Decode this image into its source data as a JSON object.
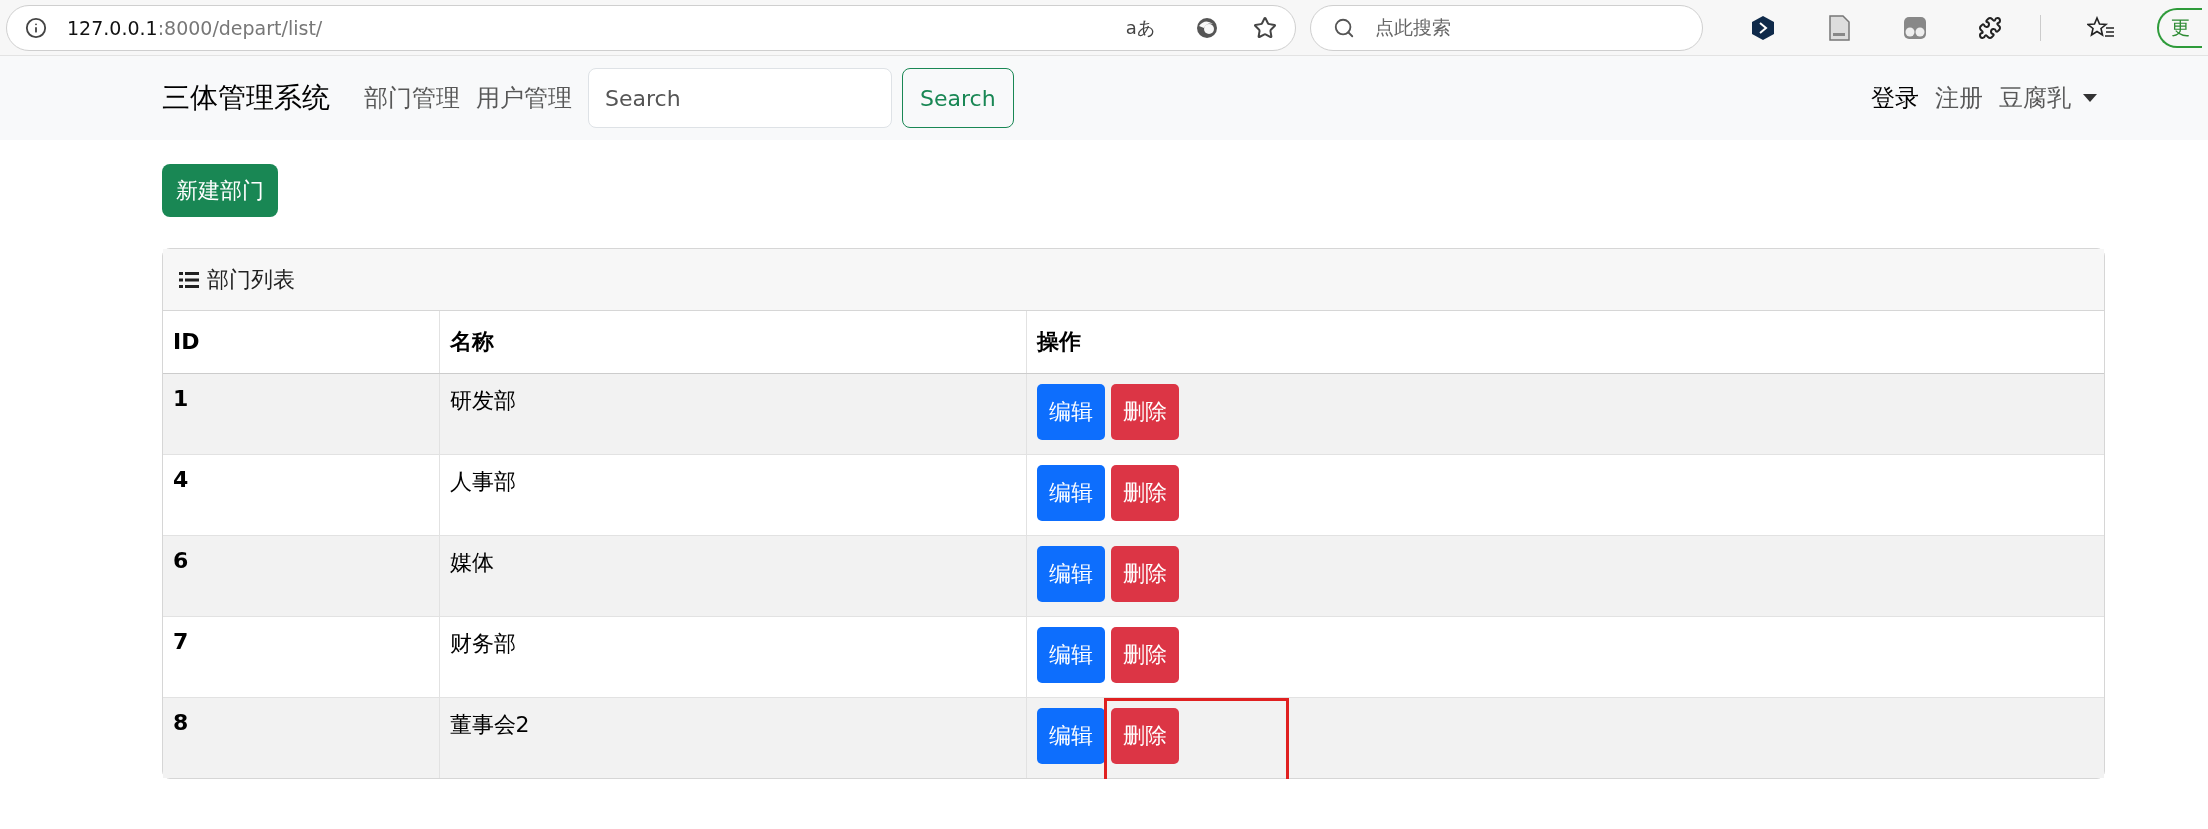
{
  "browser": {
    "url_host": "127.0.0.1",
    "url_path": ":8000/depart/list/",
    "translate_label": "aあ",
    "search_placeholder": "点此搜索",
    "update_label": "更"
  },
  "navbar": {
    "brand": "三体管理系统",
    "links": [
      "部门管理",
      "用户管理"
    ],
    "search": {
      "placeholder": "Search",
      "button": "Search"
    },
    "right": [
      {
        "label": "登录",
        "kind": "link",
        "selected": true
      },
      {
        "label": "注册",
        "kind": "link",
        "selected": false
      },
      {
        "label": "豆腐乳",
        "kind": "dropdown",
        "selected": false
      }
    ]
  },
  "new_button": "新建部门",
  "panel": {
    "title": "部门列表",
    "columns": [
      "ID",
      "名称",
      "操作"
    ],
    "rows": [
      {
        "id": "1",
        "name": "研发部",
        "actions": [
          "编辑",
          "删除"
        ],
        "highlighted": false
      },
      {
        "id": "4",
        "name": "人事部",
        "actions": [
          "编辑",
          "删除"
        ],
        "highlighted": false
      },
      {
        "id": "6",
        "name": "媒体",
        "actions": [
          "编辑",
          "删除"
        ],
        "highlighted": false
      },
      {
        "id": "7",
        "name": "财务部",
        "actions": [
          "编辑",
          "删除"
        ],
        "highlighted": false
      },
      {
        "id": "8",
        "name": "董事会2",
        "actions": [
          "编辑",
          "删除"
        ],
        "highlighted": true
      }
    ]
  }
}
